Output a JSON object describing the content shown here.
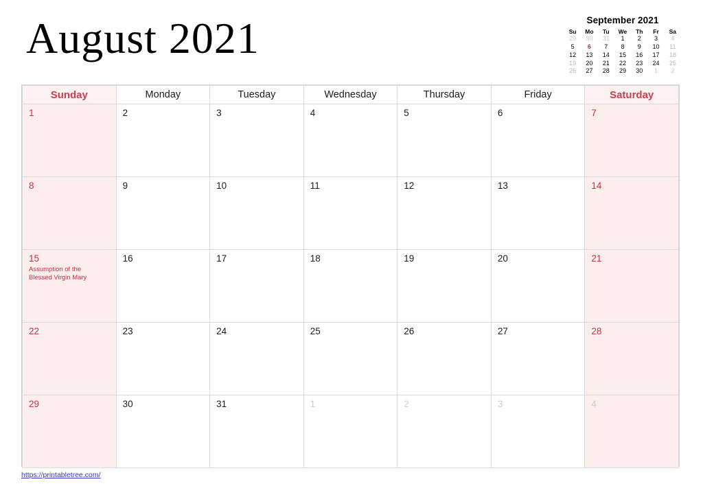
{
  "header": {
    "title": "August 2021"
  },
  "mini_calendar": {
    "title": "September 2021",
    "weekday_headers": [
      "Su",
      "Mo",
      "Tu",
      "We",
      "Th",
      "Fr",
      "Sa"
    ],
    "weeks": [
      [
        {
          "d": "29",
          "style": "muted"
        },
        {
          "d": "30",
          "style": "muted"
        },
        {
          "d": "31",
          "style": "muted"
        },
        {
          "d": "1",
          "style": ""
        },
        {
          "d": "2",
          "style": ""
        },
        {
          "d": "3",
          "style": ""
        },
        {
          "d": "4",
          "style": "sat"
        }
      ],
      [
        {
          "d": "5",
          "style": ""
        },
        {
          "d": "6",
          "style": "hl"
        },
        {
          "d": "7",
          "style": ""
        },
        {
          "d": "8",
          "style": ""
        },
        {
          "d": "9",
          "style": ""
        },
        {
          "d": "10",
          "style": ""
        },
        {
          "d": "11",
          "style": "sat"
        }
      ],
      [
        {
          "d": "12",
          "style": ""
        },
        {
          "d": "13",
          "style": ""
        },
        {
          "d": "14",
          "style": ""
        },
        {
          "d": "15",
          "style": ""
        },
        {
          "d": "16",
          "style": ""
        },
        {
          "d": "17",
          "style": ""
        },
        {
          "d": "18",
          "style": "sat"
        }
      ],
      [
        {
          "d": "19",
          "style": "sat"
        },
        {
          "d": "20",
          "style": ""
        },
        {
          "d": "21",
          "style": ""
        },
        {
          "d": "22",
          "style": ""
        },
        {
          "d": "23",
          "style": ""
        },
        {
          "d": "24",
          "style": ""
        },
        {
          "d": "25",
          "style": "sat"
        }
      ],
      [
        {
          "d": "26",
          "style": "sat"
        },
        {
          "d": "27",
          "style": ""
        },
        {
          "d": "28",
          "style": ""
        },
        {
          "d": "29",
          "style": ""
        },
        {
          "d": "30",
          "style": ""
        },
        {
          "d": "1",
          "style": "muted"
        },
        {
          "d": "2",
          "style": "muted"
        }
      ]
    ]
  },
  "calendar": {
    "weekday_headers": [
      {
        "label": "Sunday",
        "weekend": true
      },
      {
        "label": "Monday",
        "weekend": false
      },
      {
        "label": "Tuesday",
        "weekend": false
      },
      {
        "label": "Wednesday",
        "weekend": false
      },
      {
        "label": "Thursday",
        "weekend": false
      },
      {
        "label": "Friday",
        "weekend": false
      },
      {
        "label": "Saturday",
        "weekend": true
      }
    ],
    "weeks": [
      [
        {
          "day": "1",
          "kind": "sun",
          "event": ""
        },
        {
          "day": "2",
          "kind": "week",
          "event": ""
        },
        {
          "day": "3",
          "kind": "week",
          "event": ""
        },
        {
          "day": "4",
          "kind": "week",
          "event": ""
        },
        {
          "day": "5",
          "kind": "week",
          "event": ""
        },
        {
          "day": "6",
          "kind": "week",
          "event": ""
        },
        {
          "day": "7",
          "kind": "sat",
          "event": ""
        }
      ],
      [
        {
          "day": "8",
          "kind": "sun",
          "event": ""
        },
        {
          "day": "9",
          "kind": "week",
          "event": ""
        },
        {
          "day": "10",
          "kind": "week",
          "event": ""
        },
        {
          "day": "11",
          "kind": "week",
          "event": ""
        },
        {
          "day": "12",
          "kind": "week",
          "event": ""
        },
        {
          "day": "13",
          "kind": "week",
          "event": ""
        },
        {
          "day": "14",
          "kind": "sat",
          "event": ""
        }
      ],
      [
        {
          "day": "15",
          "kind": "sun",
          "event": "Assumption of the Blessed Virgin Mary"
        },
        {
          "day": "16",
          "kind": "week",
          "event": ""
        },
        {
          "day": "17",
          "kind": "week",
          "event": ""
        },
        {
          "day": "18",
          "kind": "week",
          "event": ""
        },
        {
          "day": "19",
          "kind": "week",
          "event": ""
        },
        {
          "day": "20",
          "kind": "week",
          "event": ""
        },
        {
          "day": "21",
          "kind": "sat",
          "event": ""
        }
      ],
      [
        {
          "day": "22",
          "kind": "sun",
          "event": ""
        },
        {
          "day": "23",
          "kind": "week",
          "event": ""
        },
        {
          "day": "24",
          "kind": "week",
          "event": ""
        },
        {
          "day": "25",
          "kind": "week",
          "event": ""
        },
        {
          "day": "26",
          "kind": "week",
          "event": ""
        },
        {
          "day": "27",
          "kind": "week",
          "event": ""
        },
        {
          "day": "28",
          "kind": "sat",
          "event": ""
        }
      ],
      [
        {
          "day": "29",
          "kind": "sun",
          "event": ""
        },
        {
          "day": "30",
          "kind": "week",
          "event": ""
        },
        {
          "day": "31",
          "kind": "week",
          "event": ""
        },
        {
          "day": "1",
          "kind": "next",
          "event": ""
        },
        {
          "day": "2",
          "kind": "next",
          "event": ""
        },
        {
          "day": "3",
          "kind": "next",
          "event": ""
        },
        {
          "day": "4",
          "kind": "next-sat",
          "event": ""
        }
      ]
    ]
  },
  "footer": {
    "url": "https://printabletree.com/"
  },
  "colors": {
    "weekend_bg": "#fdeeee",
    "weekend_text": "#c4333f",
    "grid_line": "#d9d9d9",
    "link": "#3333cc",
    "muted": "#cccccc"
  }
}
